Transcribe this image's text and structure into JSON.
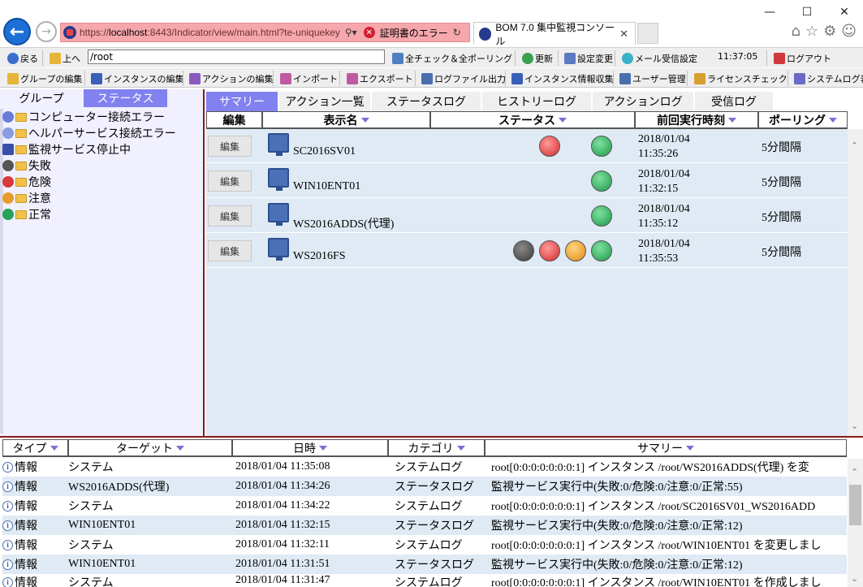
{
  "browser": {
    "url_prefix": "https://",
    "url_host": "localhost",
    "url_rest": ":8443/Indicator/view/main.html?te-uniquekey",
    "cert_error": "証明書のエラー",
    "tab_title": "BOM 7.0 集中監視コンソール"
  },
  "toolbar": {
    "back": "戻る",
    "up": "上へ",
    "path": "/root",
    "check_all": "全チェック＆全ポーリング",
    "refresh": "更新",
    "settings": "設定変更",
    "mail_settings": "メール受信設定",
    "clock": "11:37:05",
    "logout": "ログアウト",
    "group_edit": "グループの編集",
    "instance_edit": "インスタンスの編集",
    "action_edit": "アクションの編集",
    "import": "インポート",
    "export": "エクスポート",
    "logfile_out": "ログファイル出力",
    "instance_collect": "インスタンス情報収集",
    "user_mgmt": "ユーザー管理",
    "license_check": "ライセンスチェック",
    "syslog_view": "システムログ表"
  },
  "left": {
    "tab_group": "グループ",
    "tab_status": "ステータス",
    "items": [
      {
        "label": "コンピューター接続エラー",
        "color": "#6a7bd6"
      },
      {
        "label": "ヘルパーサービス接続エラー",
        "color": "#8a9be0"
      },
      {
        "label": "監視サービス停止中",
        "color": "#3a4fa8"
      },
      {
        "label": "失敗",
        "color": "#555555"
      },
      {
        "label": "危険",
        "color": "#d83a3a"
      },
      {
        "label": "注意",
        "color": "#e89a2a"
      },
      {
        "label": "正常",
        "color": "#2aa05a"
      }
    ]
  },
  "main": {
    "tabs": [
      "サマリー",
      "アクション一覧",
      "ステータスログ",
      "ヒストリーログ",
      "アクションログ",
      "受信ログ"
    ],
    "headers": {
      "edit": "編集",
      "name": "表示名",
      "status": "ステータス",
      "last_run": "前回実行時刻",
      "polling": "ポーリング"
    },
    "rows": [
      {
        "edit": "編集",
        "name": "SC2016SV01",
        "date": "2018/01/04",
        "time": "11:35:26",
        "polling": "5分間隔",
        "lamps": [
          "red",
          "green"
        ]
      },
      {
        "edit": "編集",
        "name": "WIN10ENT01",
        "date": "2018/01/04",
        "time": "11:32:15",
        "polling": "5分間隔",
        "lamps": [
          "green"
        ]
      },
      {
        "edit": "編集",
        "name": "WS2016ADDS(代理)",
        "date": "2018/01/04",
        "time": "11:35:12",
        "polling": "5分間隔",
        "lamps": [
          "green"
        ]
      },
      {
        "edit": "編集",
        "name": "WS2016FS",
        "date": "2018/01/04",
        "time": "11:35:53",
        "polling": "5分間隔",
        "lamps": [
          "black",
          "red",
          "orange",
          "green"
        ]
      }
    ]
  },
  "log": {
    "headers": {
      "type": "タイプ",
      "target": "ターゲット",
      "datetime": "日時",
      "category": "カテゴリ",
      "summary": "サマリー"
    },
    "rows": [
      {
        "type": "情報",
        "target": "システム",
        "datetime": "2018/01/04 11:35:08",
        "category": "システムログ",
        "summary": "root[0:0:0:0:0:0:0:1] インスタンス /root/WS2016ADDS(代理) を変"
      },
      {
        "type": "情報",
        "target": "WS2016ADDS(代理)",
        "datetime": "2018/01/04 11:34:26",
        "category": "ステータスログ",
        "summary": "監視サービス実行中(失敗:0/危険:0/注意:0/正常:55)"
      },
      {
        "type": "情報",
        "target": "システム",
        "datetime": "2018/01/04 11:34:22",
        "category": "システムログ",
        "summary": "root[0:0:0:0:0:0:0:1] インスタンス /root/SC2016SV01_WS2016ADD"
      },
      {
        "type": "情報",
        "target": "WIN10ENT01",
        "datetime": "2018/01/04 11:32:15",
        "category": "ステータスログ",
        "summary": "監視サービス実行中(失敗:0/危険:0/注意:0/正常:12)"
      },
      {
        "type": "情報",
        "target": "システム",
        "datetime": "2018/01/04 11:32:11",
        "category": "システムログ",
        "summary": "root[0:0:0:0:0:0:0:1] インスタンス /root/WIN10ENT01 を変更しまし"
      },
      {
        "type": "情報",
        "target": "WIN10ENT01",
        "datetime": "2018/01/04 11:31:51",
        "category": "ステータスログ",
        "summary": "監視サービス実行中(失敗:0/危険:0/注意:0/正常:12)"
      },
      {
        "type": "情報",
        "target": "システム",
        "datetime": "2018/01/04 11:31:47",
        "category": "システムログ",
        "summary": "root[0:0:0:0:0:0:0:1] インスタンス /root/WIN10ENT01 を作成しまし"
      }
    ]
  }
}
